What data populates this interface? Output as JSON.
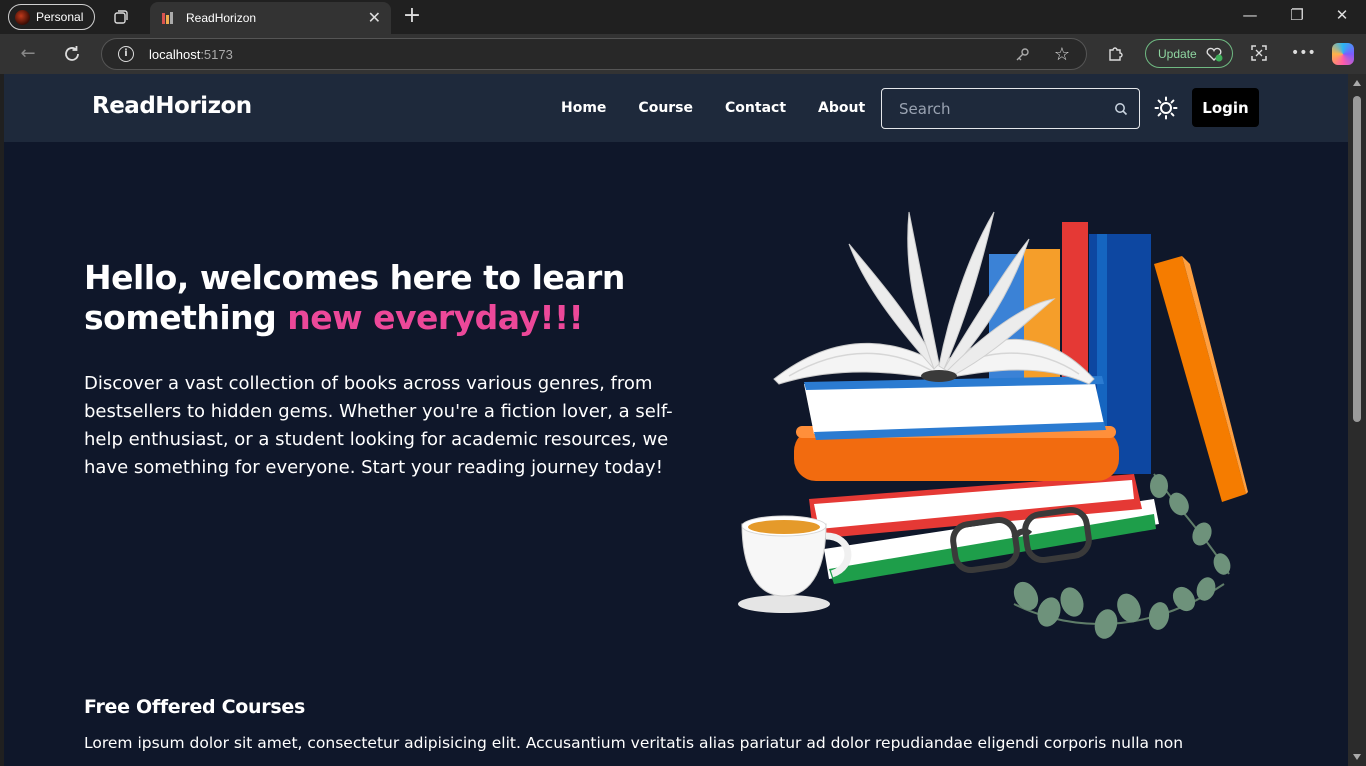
{
  "browser": {
    "profile_label": "Personal",
    "tab_title": "ReadHorizon",
    "url_host": "localhost",
    "url_port": ":5173",
    "update_label": "Update"
  },
  "site": {
    "brand": "ReadHorizon",
    "nav": [
      "Home",
      "Course",
      "Contact",
      "About"
    ],
    "search_placeholder": "Search",
    "login_label": "Login",
    "colors": {
      "background": "#0f172a",
      "navbar": "#1e293b",
      "accent": "#ec4899"
    }
  },
  "hero": {
    "title_main": "Hello, welcomes here to learn something ",
    "title_accent": "new everyday!!!",
    "description": "Discover a vast collection of books across various genres, from bestsellers to hidden gems. Whether you're a fiction lover, a self-help enthusiast, or a student looking for academic resources, we have something for everyone. Start your reading journey today!"
  },
  "courses": {
    "title": "Free Offered Courses",
    "text": "Lorem ipsum dolor sit amet, consectetur adipisicing elit. Accusantium veritatis alias pariatur ad dolor repudiandae eligendi corporis nulla non"
  }
}
